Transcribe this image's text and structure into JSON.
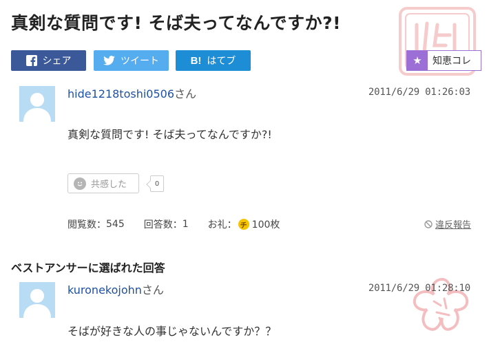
{
  "question": {
    "title": "真剣な質問です! そば夫ってなんですか?!",
    "user": {
      "name": "hide1218toshi0506",
      "honorific": "さん"
    },
    "datetime": "2011/6/29  01:26:03",
    "body": "真剣な質問です! そば夫ってなんですか?!",
    "empathy": {
      "label": "共感した",
      "count": "0"
    },
    "stats": {
      "views_label": "閲覧数：",
      "views": "545",
      "answers_label": "回答数：",
      "answers": "1",
      "reward_label": "お礼：",
      "reward_icon": "チ",
      "reward": "100枚"
    },
    "report_label": "違反報告"
  },
  "share": {
    "facebook": "シェア",
    "twitter": "ツイート",
    "hatena_icon": "B!",
    "hatena": "はてブ",
    "chiekore": "知恵コレ"
  },
  "stamps": {
    "solved": "済解決",
    "sakura": "ベストアンサー"
  },
  "best_answer": {
    "heading": "ベストアンサーに選ばれた回答",
    "user": {
      "name": "kuronekojohn",
      "honorific": "さん"
    },
    "datetime": "2011/6/29  01:28:10",
    "body": "そばが好きな人の事じゃないんですか？？"
  },
  "colors": {
    "facebook": "#3b5998",
    "twitter": "#55acee",
    "hatena": "#1d8dd6",
    "chiekore": "#9b6fd6",
    "link": "#1e50a2",
    "stamp": "#e0474c"
  }
}
